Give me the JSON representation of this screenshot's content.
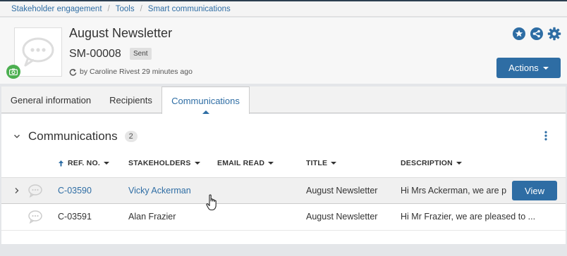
{
  "breadcrumb": [
    "Stakeholder engagement",
    "Tools",
    "Smart communications"
  ],
  "record": {
    "title": "August Newsletter",
    "code": "SM-00008",
    "status": "Sent",
    "meta": "by Caroline Rivest 29 minutes ago"
  },
  "header_icons": [
    "star-icon",
    "share-icon",
    "gear-icon"
  ],
  "actions_label": "Actions",
  "tabs": [
    {
      "label": "General information",
      "active": false
    },
    {
      "label": "Recipients",
      "active": false
    },
    {
      "label": "Communications",
      "active": true
    }
  ],
  "section": {
    "title": "Communications",
    "count": "2"
  },
  "columns": [
    "REF. NO.",
    "STAKEHOLDERS",
    "EMAIL READ",
    "TITLE",
    "DESCRIPTION"
  ],
  "rows": [
    {
      "ref": "C-03590",
      "stakeholder": "Vicky Ackerman",
      "email_read": "",
      "title": "August Newsletter",
      "description": "Hi Mrs Ackerman, we are p",
      "action": "View"
    },
    {
      "ref": "C-03591",
      "stakeholder": "Alan Frazier",
      "email_read": "",
      "title": "August Newsletter",
      "description": "Hi Mr Frazier, we are pleased to ...",
      "action": ""
    }
  ],
  "colors": {
    "accent": "#2e6da4",
    "camera": "#4caf50"
  }
}
